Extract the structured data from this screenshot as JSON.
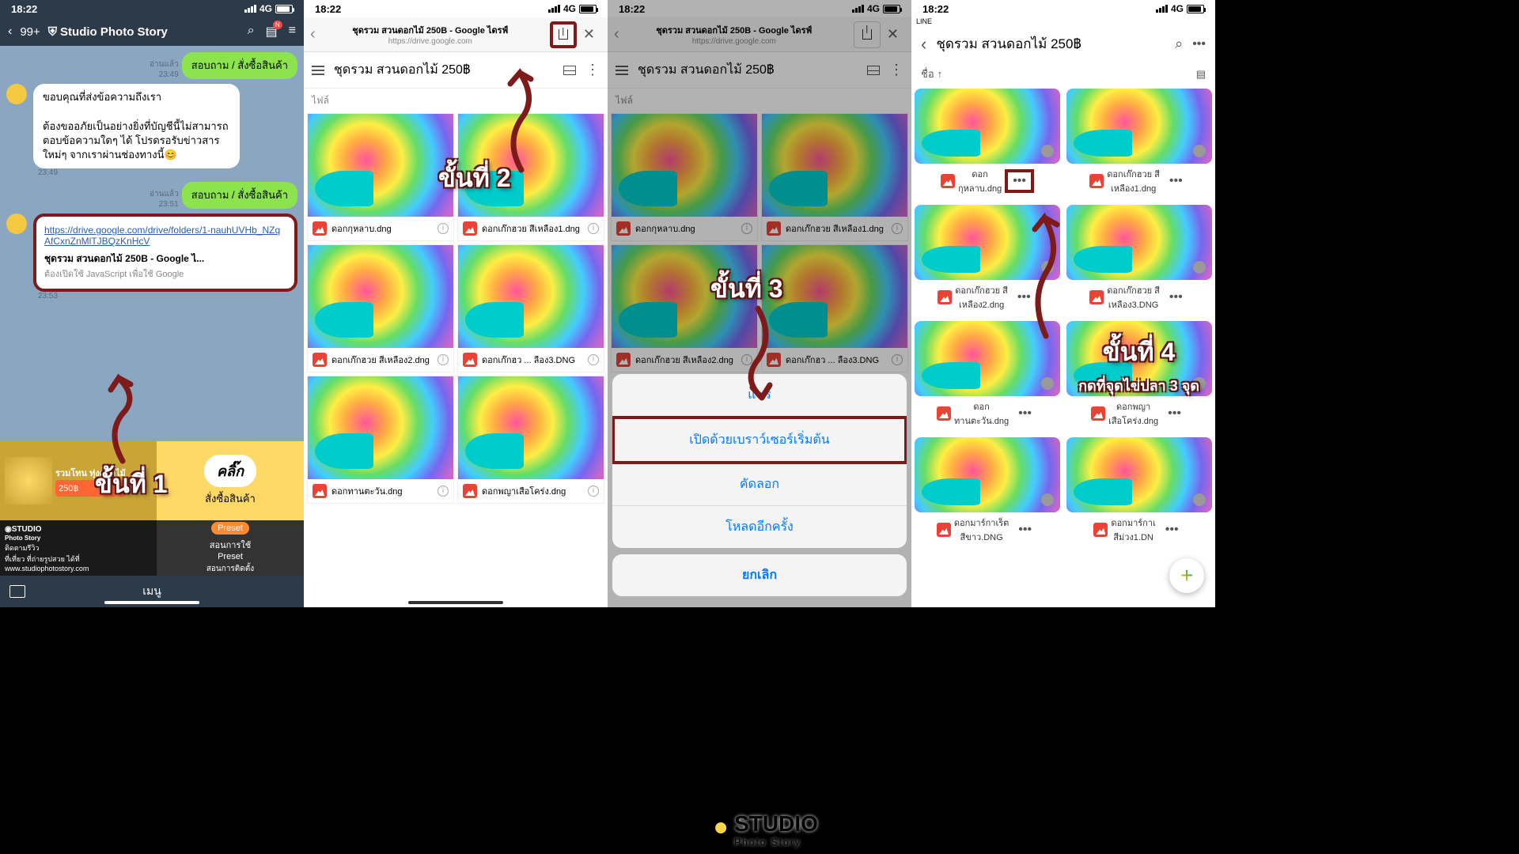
{
  "status": {
    "time": "18:22",
    "net": "4G"
  },
  "line_back_src": "LINE",
  "chat": {
    "badge": "99+",
    "title": "Studio Photo Story",
    "read": "อ่านแล้ว",
    "t1": "23:49",
    "t2": "23:49",
    "t3": "23:51",
    "t4": "23:53",
    "ask": "สอบถาม / สั่งซื้อสินค้า",
    "reply": "ขอบคุณที่ส่งข้อความถึงเรา\n\nต้องขออภัยเป็นอย่างยิ่งที่บัญชีนี้ไม่สามารถตอบข้อความใดๆ ได้ โปรดรอรับข่าวสารใหม่ๆ จากเราผ่านช่องทางนี้😊",
    "link": "https://drive.google.com/drive/folders/1-nauhUVHb_NZqAfCxnZnMlTJBQzKnHcV",
    "link_title": "ชุดรวม สวนดอกไม้ 250B - Google ไ...",
    "link_sub": "ต้องเปิดใช้ JavaScript เพื่อใช้ Google"
  },
  "banner": {
    "promo": "รวมโทน ทุ่งดอกไม้",
    "price": "250฿",
    "click": "คลิ๊ก",
    "order": "สั่งซื้อสินค้า",
    "studio_tag": "ติดตามรีวิว",
    "studio_line": "ที่เที่ยว ที่ถ่ายรูปสวย ได้ที่",
    "studio_url": "www.studiophotostory.com",
    "preset": "Preset",
    "learn": "สอนการใช้\nPreset",
    "install": "สอนการติดตั้ง",
    "menu": "เมนู"
  },
  "browser": {
    "title": "ชุดรวม สวนดอกไม้ 250B - Google ไดรฟ์",
    "url": "https://drive.google.com",
    "folder": "ชุดรวม สวนดอกไม้ 250฿",
    "files_label": "ไฟล์"
  },
  "files": [
    "ดอกกุหลาบ.dng",
    "ดอกเก๊กฮวย สีเหลือง1.dng",
    "ดอกเก๊กฮวย สีเหลือง2.dng",
    "ดอกเก๊กฮว ... ลือง3.DNG",
    "ดอกทานตะวัน.dng",
    "ดอกพญาเสือโคร่ง.dng"
  ],
  "files4": [
    "ดอก\nกุหลาบ.dng",
    "ดอกเก๊กฮวย สี\nเหลือง1.dng",
    "ดอกเก๊กฮวย สี\nเหลือง2.dng",
    "ดอกเก๊กฮวย สี\nเหลือง3.DNG",
    "ดอก\nทานตะวัน.dng",
    "ดอกพญา\nเสือโคร่ง.dng",
    "ดอกมาร์กาเร็ต\nสีขาว.DNG",
    "ดอกมาร์กาเ\nสีม่วง1.DN"
  ],
  "sheet": {
    "share": "แชร์",
    "open": "เปิดด้วยเบราว์เซอร์เริ่มต้น",
    "copy": "คัดลอก",
    "reload": "โหลดอีกครั้ง",
    "cancel": "ยกเลิก"
  },
  "drive4": {
    "sort": "ชื่อ"
  },
  "steps": {
    "s1": "ขั้นที่ 1",
    "s2": "ขั้นที่ 2",
    "s3": "ขั้นที่ 3",
    "s4": "ขั้นที่ 4",
    "s4sub": "กดที่จุดไข่ปลา 3 จุด"
  },
  "watermark": {
    "main": "STUDIO",
    "sub": "Photo Story"
  }
}
